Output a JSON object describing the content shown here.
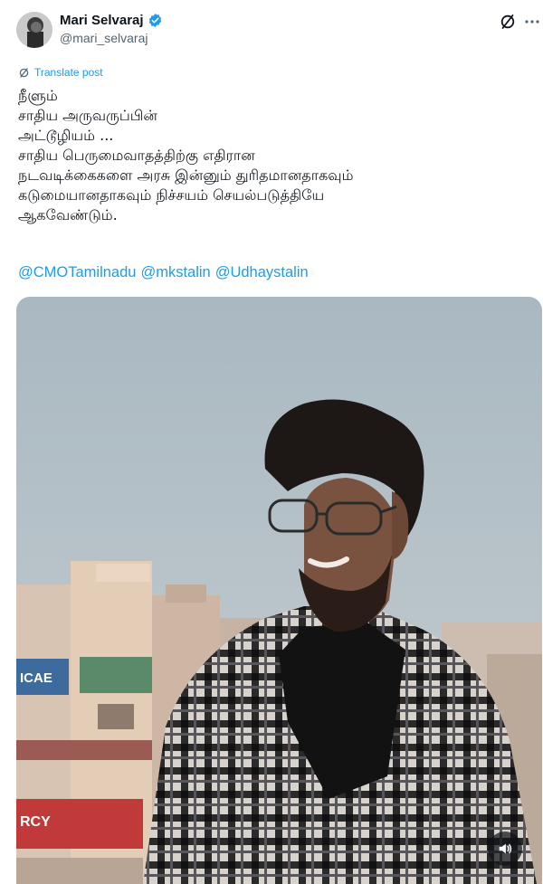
{
  "author": {
    "display_name": "Mari Selvaraj",
    "handle": "@mari_selvaraj",
    "verified": true,
    "avatar_icon": "avatar-photo"
  },
  "header_icons": {
    "grok": "grok-icon",
    "more": "more-options-icon"
  },
  "translate": {
    "label": "Translate post",
    "icon": "translate-icon"
  },
  "tweet": {
    "lines": [
      "நீளும்",
      "சாதிய அருவருப்பின்",
      "அட்டூழியம் ...",
      "சாதிய பெருமைவாதத்திற்கு எதிரான",
      "நடவடிக்கைகளை அரசு இன்னும் துரிதமானதாகவும்",
      "கடுமையானதாகவும் நிச்சயம் செயல்படுத்தியே",
      "ஆகவேண்டும்."
    ],
    "mentions": [
      "@CMOTamilnadu",
      "@mkstalin",
      "@Udhaystalin"
    ]
  },
  "media": {
    "type": "video",
    "sign_texts": [
      "ICAE",
      "RCY"
    ],
    "sound_icon": "speaker-icon"
  },
  "colors": {
    "link": "#1d9bf0",
    "text": "#0f1419",
    "secondary": "#536471",
    "sky": "#b9c4cc"
  }
}
